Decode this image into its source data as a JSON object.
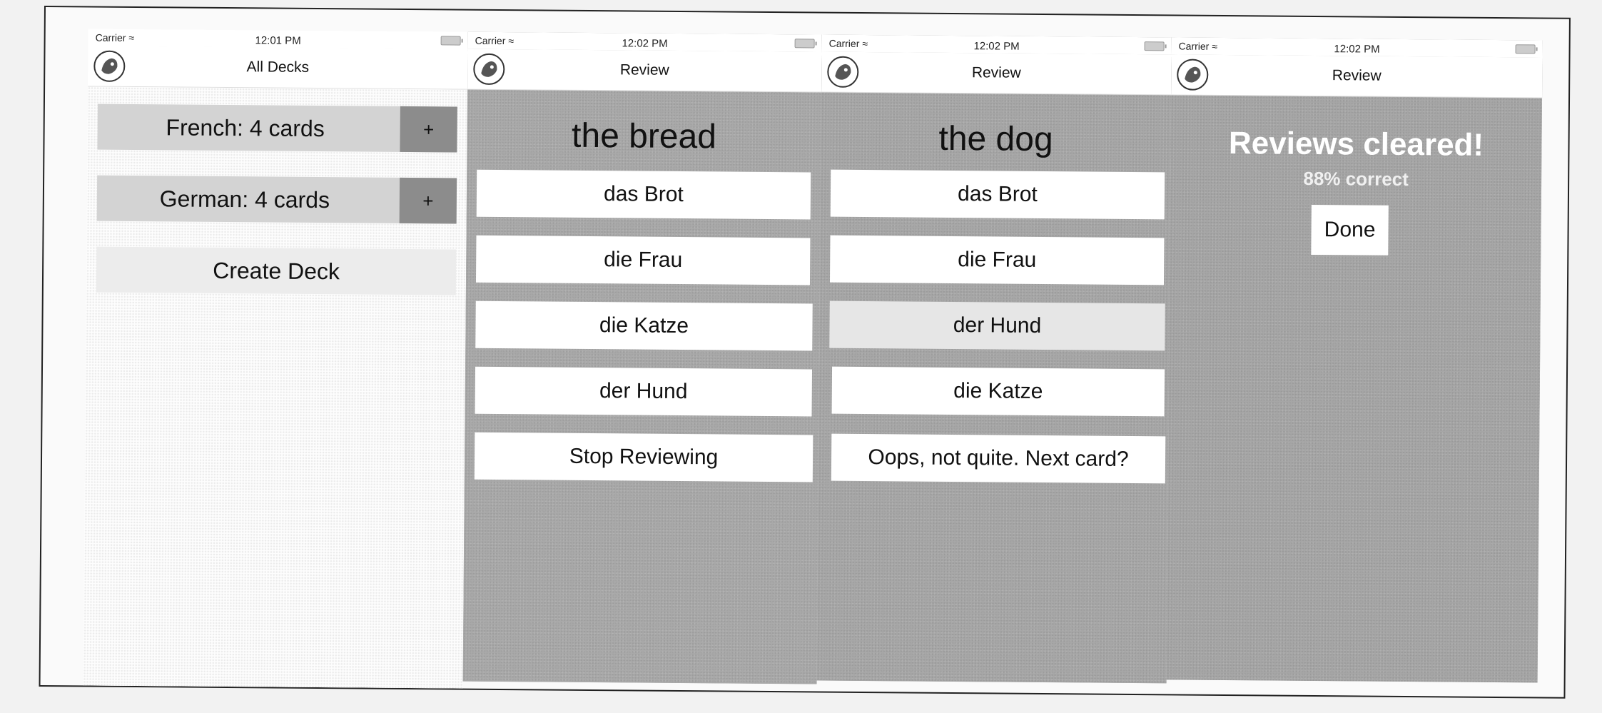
{
  "screens": [
    {
      "status": {
        "carrier": "Carrier",
        "time": "12:01 PM"
      },
      "title": "All Decks",
      "decks": [
        {
          "label": "French: 4 cards",
          "add": "+"
        },
        {
          "label": "German: 4 cards",
          "add": "+"
        }
      ],
      "create_label": "Create Deck"
    },
    {
      "status": {
        "carrier": "Carrier",
        "time": "12:02 PM"
      },
      "title": "Review",
      "prompt": "the bread",
      "answers": [
        "das Brot",
        "die Frau",
        "die Katze",
        "der Hund"
      ],
      "stop_label": "Stop Reviewing"
    },
    {
      "status": {
        "carrier": "Carrier",
        "time": "12:02 PM"
      },
      "title": "Review",
      "prompt": "the dog",
      "answers": [
        "das Brot",
        "die Frau",
        "der Hund",
        "die Katze"
      ],
      "feedback_label": "Oops, not quite. Next card?"
    },
    {
      "status": {
        "carrier": "Carrier",
        "time": "12:02 PM"
      },
      "title": "Review",
      "cleared_label": "Reviews cleared!",
      "percent_label": "88% correct",
      "done_label": "Done"
    }
  ],
  "icons": {
    "logo": "dog-logo-icon",
    "wifi": "wifi-icon",
    "battery": "battery-icon"
  }
}
